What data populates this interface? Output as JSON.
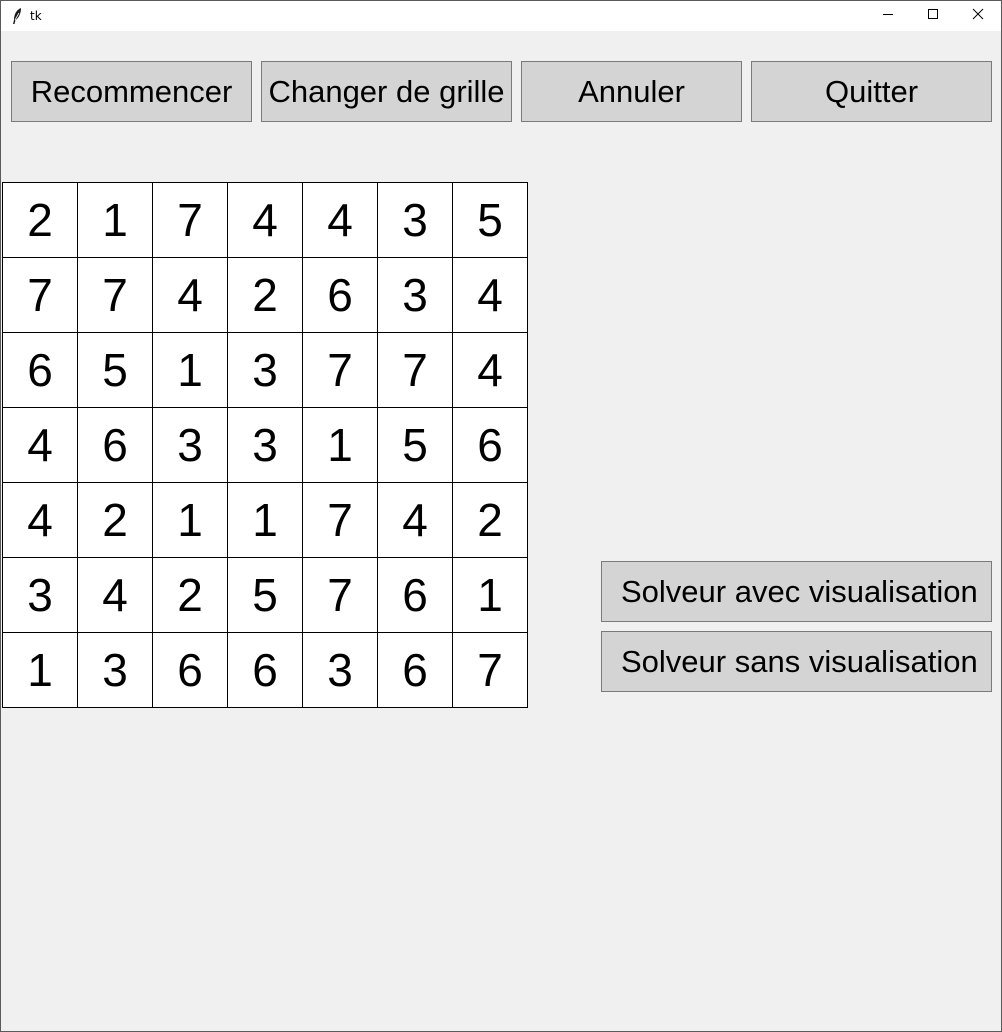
{
  "window": {
    "title": "tk"
  },
  "toolbar": {
    "restart_label": "Recommencer",
    "change_grid_label": "Changer de grille",
    "undo_label": "Annuler",
    "quit_label": "Quitter"
  },
  "grid": [
    [
      2,
      1,
      7,
      4,
      4,
      3,
      5
    ],
    [
      7,
      7,
      4,
      2,
      6,
      3,
      4
    ],
    [
      6,
      5,
      1,
      3,
      7,
      7,
      4
    ],
    [
      4,
      6,
      3,
      3,
      1,
      5,
      6
    ],
    [
      4,
      2,
      1,
      1,
      7,
      4,
      2
    ],
    [
      3,
      4,
      2,
      5,
      7,
      6,
      1
    ],
    [
      1,
      3,
      6,
      6,
      3,
      6,
      7
    ]
  ],
  "solver": {
    "with_visualization_label": "Solveur avec visualisation",
    "without_visualization_label": "Solveur sans visualisation"
  },
  "icons": {
    "app": "feather-icon",
    "minimize": "minimize-icon",
    "maximize": "maximize-icon",
    "close": "close-icon"
  }
}
